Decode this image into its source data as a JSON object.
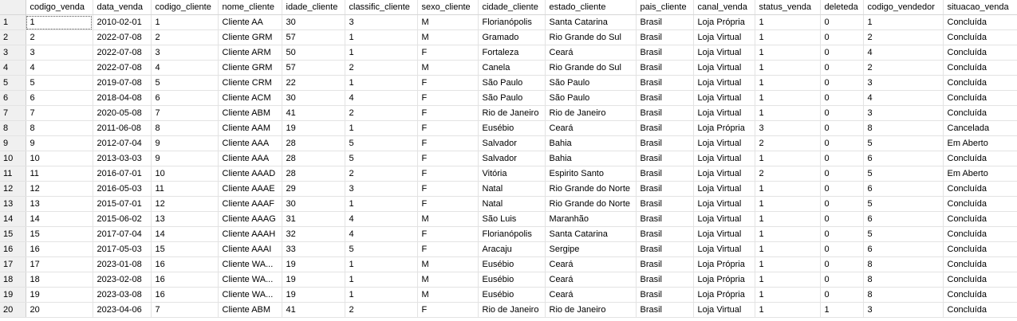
{
  "columns": [
    "codigo_venda",
    "data_venda",
    "codigo_cliente",
    "nome_cliente",
    "idade_cliente",
    "classific_cliente",
    "sexo_cliente",
    "cidade_cliente",
    "estado_cliente",
    "pais_cliente",
    "canal_venda",
    "status_venda",
    "deleteda",
    "codigo_vendedor",
    "situacao_venda"
  ],
  "rows": [
    {
      "n": "1",
      "cells": [
        "1",
        "2010-02-01",
        "1",
        "Cliente AA",
        "30",
        "3",
        "M",
        "Florianópolis",
        "Santa Catarina",
        "Brasil",
        "Loja Própria",
        "1",
        "0",
        "1",
        "Concluída"
      ]
    },
    {
      "n": "2",
      "cells": [
        "2",
        "2022-07-08",
        "2",
        "Cliente GRM",
        "57",
        "1",
        "M",
        "Gramado",
        "Rio Grande do Sul",
        "Brasil",
        "Loja Virtual",
        "1",
        "0",
        "2",
        "Concluída"
      ]
    },
    {
      "n": "3",
      "cells": [
        "3",
        "2022-07-08",
        "3",
        "Cliente ARM",
        "50",
        "1",
        "F",
        "Fortaleza",
        "Ceará",
        "Brasil",
        "Loja Virtual",
        "1",
        "0",
        "4",
        "Concluída"
      ]
    },
    {
      "n": "4",
      "cells": [
        "4",
        "2022-07-08",
        "4",
        "Cliente GRM",
        "57",
        "2",
        "M",
        "Canela",
        "Rio Grande do Sul",
        "Brasil",
        "Loja Virtual",
        "1",
        "0",
        "2",
        "Concluída"
      ]
    },
    {
      "n": "5",
      "cells": [
        "5",
        "2019-07-08",
        "5",
        "Cliente CRM",
        "22",
        "1",
        "F",
        "São Paulo",
        "São Paulo",
        "Brasil",
        "Loja Virtual",
        "1",
        "0",
        "3",
        "Concluída"
      ]
    },
    {
      "n": "6",
      "cells": [
        "6",
        "2018-04-08",
        "6",
        "Cliente ACM",
        "30",
        "4",
        "F",
        "São Paulo",
        "São Paulo",
        "Brasil",
        "Loja Virtual",
        "1",
        "0",
        "4",
        "Concluída"
      ]
    },
    {
      "n": "7",
      "cells": [
        "7",
        "2020-05-08",
        "7",
        "Cliente ABM",
        "41",
        "2",
        "F",
        "Rio de Janeiro",
        "Rio de Janeiro",
        "Brasil",
        "Loja Virtual",
        "1",
        "0",
        "3",
        "Concluída"
      ]
    },
    {
      "n": "8",
      "cells": [
        "8",
        "2011-06-08",
        "8",
        "Cliente AAM",
        "19",
        "1",
        "F",
        "Eusébio",
        "Ceará",
        "Brasil",
        "Loja Própria",
        "3",
        "0",
        "8",
        "Cancelada"
      ]
    },
    {
      "n": "9",
      "cells": [
        "9",
        "2012-07-04",
        "9",
        "Cliente AAA",
        "28",
        "5",
        "F",
        "Salvador",
        "Bahia",
        "Brasil",
        "Loja Virtual",
        "2",
        "0",
        "5",
        "Em Aberto"
      ]
    },
    {
      "n": "10",
      "cells": [
        "10",
        "2013-03-03",
        "9",
        "Cliente AAA",
        "28",
        "5",
        "F",
        "Salvador",
        "Bahia",
        "Brasil",
        "Loja Virtual",
        "1",
        "0",
        "6",
        "Concluída"
      ]
    },
    {
      "n": "11",
      "cells": [
        "11",
        "2016-07-01",
        "10",
        "Cliente AAAD",
        "28",
        "2",
        "F",
        "Vitória",
        "Espirito Santo",
        "Brasil",
        "Loja Virtual",
        "2",
        "0",
        "5",
        "Em Aberto"
      ]
    },
    {
      "n": "12",
      "cells": [
        "12",
        "2016-05-03",
        "11",
        "Cliente AAAE",
        "29",
        "3",
        "F",
        "Natal",
        "Rio Grande do Norte",
        "Brasil",
        "Loja Virtual",
        "1",
        "0",
        "6",
        "Concluída"
      ]
    },
    {
      "n": "13",
      "cells": [
        "13",
        "2015-07-01",
        "12",
        "Cliente AAAF",
        "30",
        "1",
        "F",
        "Natal",
        "Rio Grande do Norte",
        "Brasil",
        "Loja Virtual",
        "1",
        "0",
        "5",
        "Concluída"
      ]
    },
    {
      "n": "14",
      "cells": [
        "14",
        "2015-06-02",
        "13",
        "Cliente AAAG",
        "31",
        "4",
        "M",
        "São Luis",
        "Maranhão",
        "Brasil",
        "Loja Virtual",
        "1",
        "0",
        "6",
        "Concluída"
      ]
    },
    {
      "n": "15",
      "cells": [
        "15",
        "2017-07-04",
        "14",
        "Cliente AAAH",
        "32",
        "4",
        "F",
        "Florianópolis",
        "Santa Catarina",
        "Brasil",
        "Loja Virtual",
        "1",
        "0",
        "5",
        "Concluída"
      ]
    },
    {
      "n": "16",
      "cells": [
        "16",
        "2017-05-03",
        "15",
        "Cliente AAAI",
        "33",
        "5",
        "F",
        "Aracaju",
        "Sergipe",
        "Brasil",
        "Loja Virtual",
        "1",
        "0",
        "6",
        "Concluída"
      ]
    },
    {
      "n": "17",
      "cells": [
        "17",
        "2023-01-08",
        "16",
        "Cliente WA...",
        "19",
        "1",
        "M",
        "Eusébio",
        "Ceará",
        "Brasil",
        "Loja Própria",
        "1",
        "0",
        "8",
        "Concluída"
      ]
    },
    {
      "n": "18",
      "cells": [
        "18",
        "2023-02-08",
        "16",
        "Cliente WA...",
        "19",
        "1",
        "M",
        "Eusébio",
        "Ceará",
        "Brasil",
        "Loja Própria",
        "1",
        "0",
        "8",
        "Concluída"
      ]
    },
    {
      "n": "19",
      "cells": [
        "19",
        "2023-03-08",
        "16",
        "Cliente WA...",
        "19",
        "1",
        "M",
        "Eusébio",
        "Ceará",
        "Brasil",
        "Loja Própria",
        "1",
        "0",
        "8",
        "Concluída"
      ]
    },
    {
      "n": "20",
      "cells": [
        "20",
        "2023-04-06",
        "7",
        "Cliente ABM",
        "41",
        "2",
        "F",
        "Rio de Janeiro",
        "Rio de Janeiro",
        "Brasil",
        "Loja Virtual",
        "1",
        "1",
        "3",
        "Concluída"
      ]
    }
  ]
}
